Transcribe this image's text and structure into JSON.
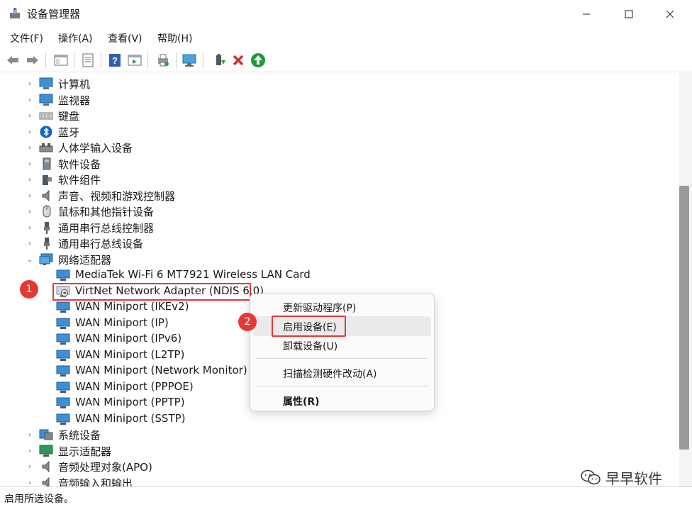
{
  "window": {
    "title": "设备管理器"
  },
  "menu": [
    "文件(F)",
    "操作(A)",
    "查看(V)",
    "帮助(H)"
  ],
  "tree": {
    "categories_top": [
      {
        "label": "计算机",
        "icon": "computer-icon"
      },
      {
        "label": "监视器",
        "icon": "monitor-icon"
      },
      {
        "label": "键盘",
        "icon": "keyboard-icon"
      },
      {
        "label": "蓝牙",
        "icon": "bluetooth-icon"
      },
      {
        "label": "人体学输入设备",
        "icon": "hid-icon"
      },
      {
        "label": "软件设备",
        "icon": "software-device-icon"
      },
      {
        "label": "软件组件",
        "icon": "software-component-icon"
      },
      {
        "label": "声音、视频和游戏控制器",
        "icon": "speaker-icon"
      },
      {
        "label": "鼠标和其他指针设备",
        "icon": "mouse-icon"
      },
      {
        "label": "通用串行总线控制器",
        "icon": "usb-icon"
      },
      {
        "label": "通用串行总线设备",
        "icon": "usb-icon"
      },
      {
        "label": "网络适配器",
        "icon": "network-icon"
      }
    ],
    "network_children": [
      "MediaTek Wi-Fi 6 MT7921 Wireless LAN Card",
      "VirtNet Network Adapter (NDIS 6.0)",
      "WAN Miniport (IKEv2)",
      "WAN Miniport (IP)",
      "WAN Miniport (IPv6)",
      "WAN Miniport (L2TP)",
      "WAN Miniport (Network Monitor)",
      "WAN Miniport (PPPOE)",
      "WAN Miniport (PPTP)",
      "WAN Miniport (SSTP)"
    ],
    "categories_bottom": [
      {
        "label": "系统设备",
        "icon": "system-device-icon"
      },
      {
        "label": "显示适配器",
        "icon": "display-adapter-icon"
      },
      {
        "label": "音频处理对象(APO)",
        "icon": "audio-apo-icon"
      },
      {
        "label": "音频输入和输出",
        "icon": "audio-io-icon"
      }
    ]
  },
  "context_menu": {
    "update_driver": "更新驱动程序(P)",
    "enable_device": "启用设备(E)",
    "uninstall_device": "卸载设备(U)",
    "scan_hardware": "扫描检测硬件改动(A)",
    "properties": "属性(R)"
  },
  "annotations": {
    "badge1": "1",
    "badge2": "2"
  },
  "status": "启用所选设备。",
  "watermark": "早早软件",
  "colors": {
    "accent_red": "#e53935",
    "menu_hover": "#eaeaea"
  }
}
